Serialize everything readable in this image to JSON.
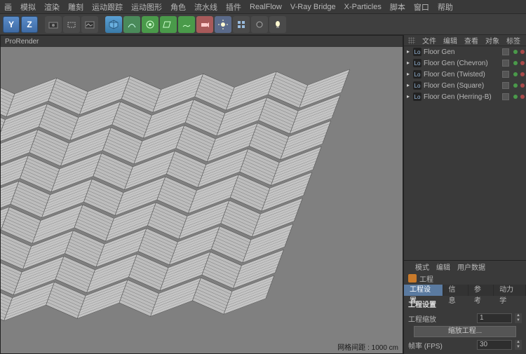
{
  "menu": [
    "画",
    "模拟",
    "渲染",
    "雕刻",
    "运动跟踪",
    "运动图形",
    "角色",
    "流水线",
    "插件",
    "RealFlow",
    "V-Ray Bridge",
    "X-Particles",
    "脚本",
    "窗口",
    "帮助"
  ],
  "viewport_title": "ProRender",
  "grid_status": "网格间距 : 1000 cm",
  "obj_panel_menu": [
    "文件",
    "编辑",
    "查看",
    "对象",
    "标签"
  ],
  "objects": [
    {
      "name": "Floor Gen"
    },
    {
      "name": "Floor Gen (Chevron)"
    },
    {
      "name": "Floor Gen (Twisted)"
    },
    {
      "name": "Floor Gen (Square)"
    },
    {
      "name": "Floor Gen (Herring-B)"
    }
  ],
  "attr_menu": [
    "模式",
    "编辑",
    "用户数据"
  ],
  "attr_title": "工程",
  "attr_tabs": [
    "工程设置",
    "信息",
    "参考",
    "动力学"
  ],
  "attr_section": "工程设置",
  "fields": {
    "scale_label": "工程缩放",
    "scale_value": "1",
    "scale_button": "缩放工程...",
    "fps_label": "帧率 (FPS)",
    "fps_value": "30"
  },
  "axis": [
    "Y",
    "Z"
  ]
}
